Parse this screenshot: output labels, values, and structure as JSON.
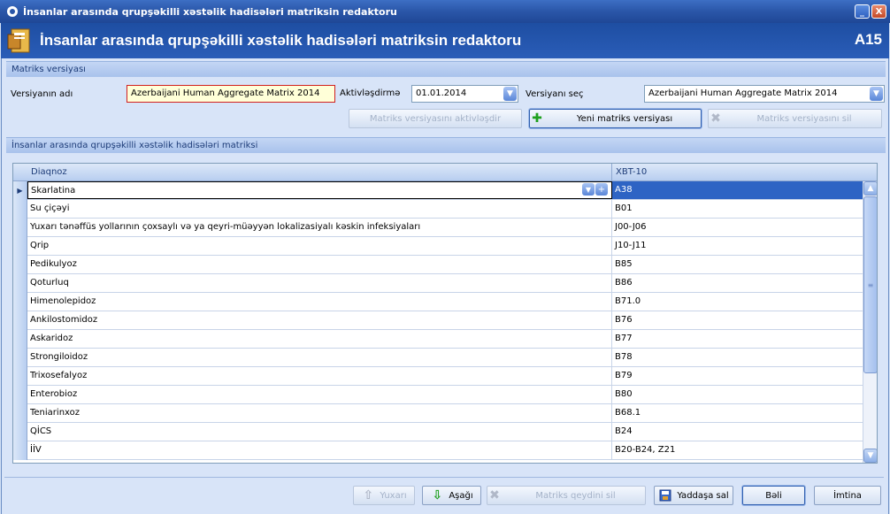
{
  "window": {
    "title": "İnsanlar arasında qrupşəkilli xəstəlik hadisələri matriksin redaktoru",
    "minimize": "_",
    "close": "X"
  },
  "header": {
    "title": "İnsanlar arasında qrupşəkilli xəstəlik hadisələri matriksin redaktoru",
    "code": "A15"
  },
  "version_group": {
    "title": "Matriks versiyası",
    "name_label": "Versiyanın adı",
    "name_value": "Azerbaijani Human Aggregate Matrix 2014",
    "activation_label": "Aktivləşdirmə",
    "activation_value": "01.01.2014",
    "select_label": "Versiyanı seç",
    "select_value": "Azerbaijani Human Aggregate Matrix 2014",
    "activate_button": "Matriks versiyasını aktivləşdir",
    "new_button": "Yeni matriks versiyası",
    "delete_button": "Matriks versiyasını sil"
  },
  "matrix_group": {
    "title": "İnsanlar arasında qrupşəkilli xəstəlik hadisələri matriksi"
  },
  "grid": {
    "columns": [
      "Diaqnoz",
      "XBT-10"
    ],
    "rows": [
      {
        "diagnosis": "Skarlatina",
        "code": "A38"
      },
      {
        "diagnosis": "Su çiçəyi",
        "code": "B01"
      },
      {
        "diagnosis": "Yuxarı tənəffüs yollarının çoxsaylı və ya qeyri-müəyyən lokalizasiyalı kəskin infeksiyaları",
        "code": "J00-J06"
      },
      {
        "diagnosis": "Qrip",
        "code": "J10-J11"
      },
      {
        "diagnosis": "Pedikulyoz",
        "code": "B85"
      },
      {
        "diagnosis": "Qoturluq",
        "code": "B86"
      },
      {
        "diagnosis": "Himenolepidoz",
        "code": "B71.0"
      },
      {
        "diagnosis": "Ankilostomidoz",
        "code": "B76"
      },
      {
        "diagnosis": "Askaridoz",
        "code": "B77"
      },
      {
        "diagnosis": "Strongiloidoz",
        "code": "B78"
      },
      {
        "diagnosis": "Trixosefalyoz",
        "code": "B79"
      },
      {
        "diagnosis": "Enterobioz",
        "code": "B80"
      },
      {
        "diagnosis": "Teniarinxoz",
        "code": "B68.1"
      },
      {
        "diagnosis": "QİCS",
        "code": "B24"
      },
      {
        "diagnosis": "İİV",
        "code": "B20-B24, Z21"
      }
    ]
  },
  "footer": {
    "up_button": "Yuxarı",
    "down_button": "Aşağı",
    "delete_button": "Matriks qeydini sil",
    "save_button": "Yaddaşa sal",
    "ok_button": "Bəli",
    "cancel_button": "İmtina"
  },
  "colors": {
    "accent": "#2e64c4",
    "header_bg": "#1e4ea2",
    "body_bg": "#d8e4f8"
  }
}
